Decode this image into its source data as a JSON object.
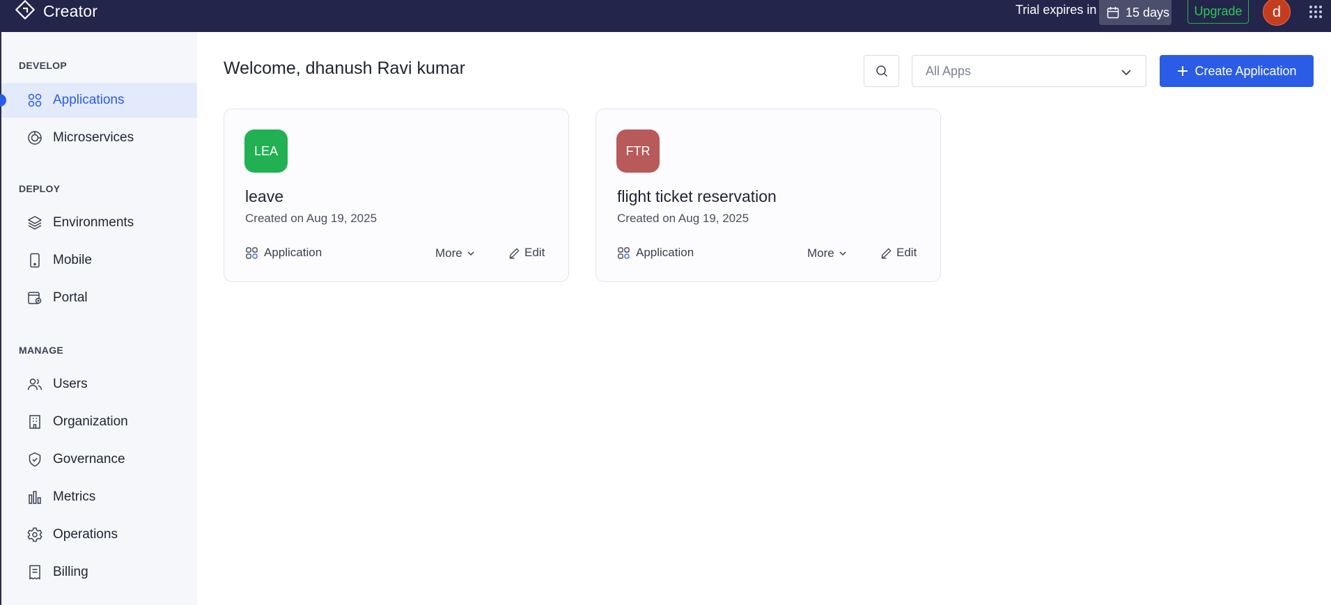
{
  "topbar": {
    "brand": "Creator",
    "trial_label": "Trial expires in",
    "trial_days": "15 days",
    "upgrade_label": "Upgrade",
    "avatar_initial": "d"
  },
  "sidebar": {
    "sections": [
      {
        "title": "DEVELOP",
        "items": [
          {
            "label": "Applications",
            "icon": "apps-icon",
            "active": true
          },
          {
            "label": "Microservices",
            "icon": "microservices-icon"
          }
        ]
      },
      {
        "title": "DEPLOY",
        "items": [
          {
            "label": "Environments",
            "icon": "layers-icon"
          },
          {
            "label": "Mobile",
            "icon": "mobile-icon"
          },
          {
            "label": "Portal",
            "icon": "portal-icon"
          }
        ]
      },
      {
        "title": "MANAGE",
        "items": [
          {
            "label": "Users",
            "icon": "users-icon"
          },
          {
            "label": "Organization",
            "icon": "building-icon"
          },
          {
            "label": "Governance",
            "icon": "shield-icon"
          },
          {
            "label": "Metrics",
            "icon": "bar-chart-icon"
          },
          {
            "label": "Operations",
            "icon": "gear-icon"
          },
          {
            "label": "Billing",
            "icon": "receipt-icon"
          }
        ]
      }
    ]
  },
  "main": {
    "welcome": "Welcome, dhanush Ravi kumar",
    "filter_selected": "All Apps",
    "create_label": "Create Application",
    "cards": [
      {
        "initials": "LEA",
        "color": "#22b152",
        "title": "leave",
        "created": "Created on Aug 19, 2025",
        "type": "Application",
        "more": "More",
        "edit": "Edit"
      },
      {
        "initials": "FTR",
        "color": "#b8595a",
        "title": "flight ticket reservation",
        "created": "Created on Aug 19, 2025",
        "type": "Application",
        "more": "More",
        "edit": "Edit"
      }
    ]
  },
  "colors": {
    "topbar": "#23264a",
    "accent": "#2b5ce6",
    "upgrade": "#2fc553"
  }
}
